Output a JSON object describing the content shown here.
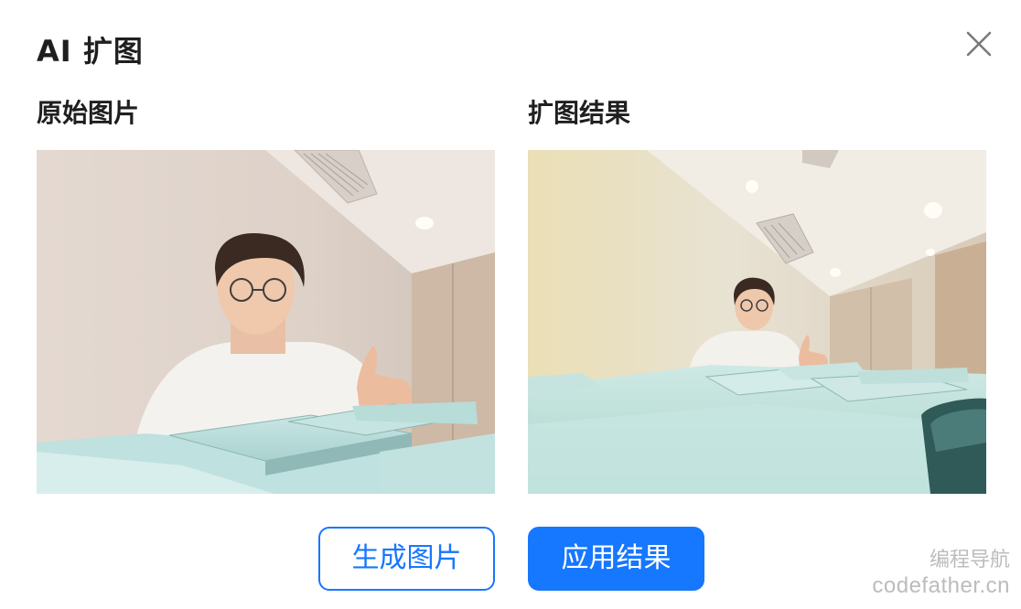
{
  "dialog": {
    "title": "AI 扩图",
    "close_icon": "close-icon"
  },
  "original": {
    "label": "原始图片"
  },
  "result": {
    "label": "扩图结果"
  },
  "actions": {
    "generate_label": "生成图片",
    "apply_label": "应用结果"
  },
  "colors": {
    "primary": "#1677ff",
    "text": "#1f1f1f",
    "watermark": "#bcbcbc"
  },
  "watermark": {
    "line1": "编程导航",
    "line2": "codefather.cn"
  }
}
